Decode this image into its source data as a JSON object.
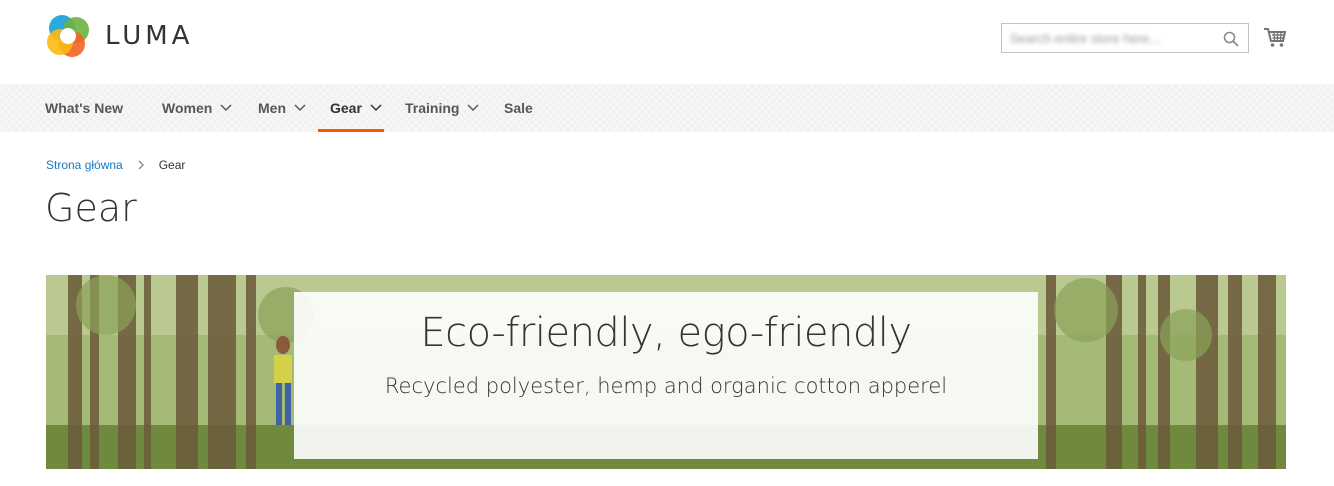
{
  "header": {
    "logo_text": "LUMA",
    "search": {
      "placeholder": "Search entire store here...",
      "value": ""
    },
    "cart_icon": "cart-icon",
    "search_icon": "search-icon"
  },
  "nav": {
    "items": [
      {
        "label": "What's New",
        "has_dropdown": false
      },
      {
        "label": "Women",
        "has_dropdown": true
      },
      {
        "label": "Men",
        "has_dropdown": true
      },
      {
        "label": "Gear",
        "has_dropdown": true,
        "active": true
      },
      {
        "label": "Training",
        "has_dropdown": true
      },
      {
        "label": "Sale",
        "has_dropdown": false
      }
    ]
  },
  "breadcrumb": {
    "home": "Strona główna",
    "current": "Gear"
  },
  "page": {
    "title": "Gear"
  },
  "banner": {
    "title": "Eco-friendly, ego-friendly",
    "subtitle": "Recycled polyester, hemp and organic cotton apperel"
  },
  "colors": {
    "accent": "#ff5501",
    "link": "#1979c3",
    "nav_bg": "#f0f0f0",
    "text": "#333333"
  }
}
